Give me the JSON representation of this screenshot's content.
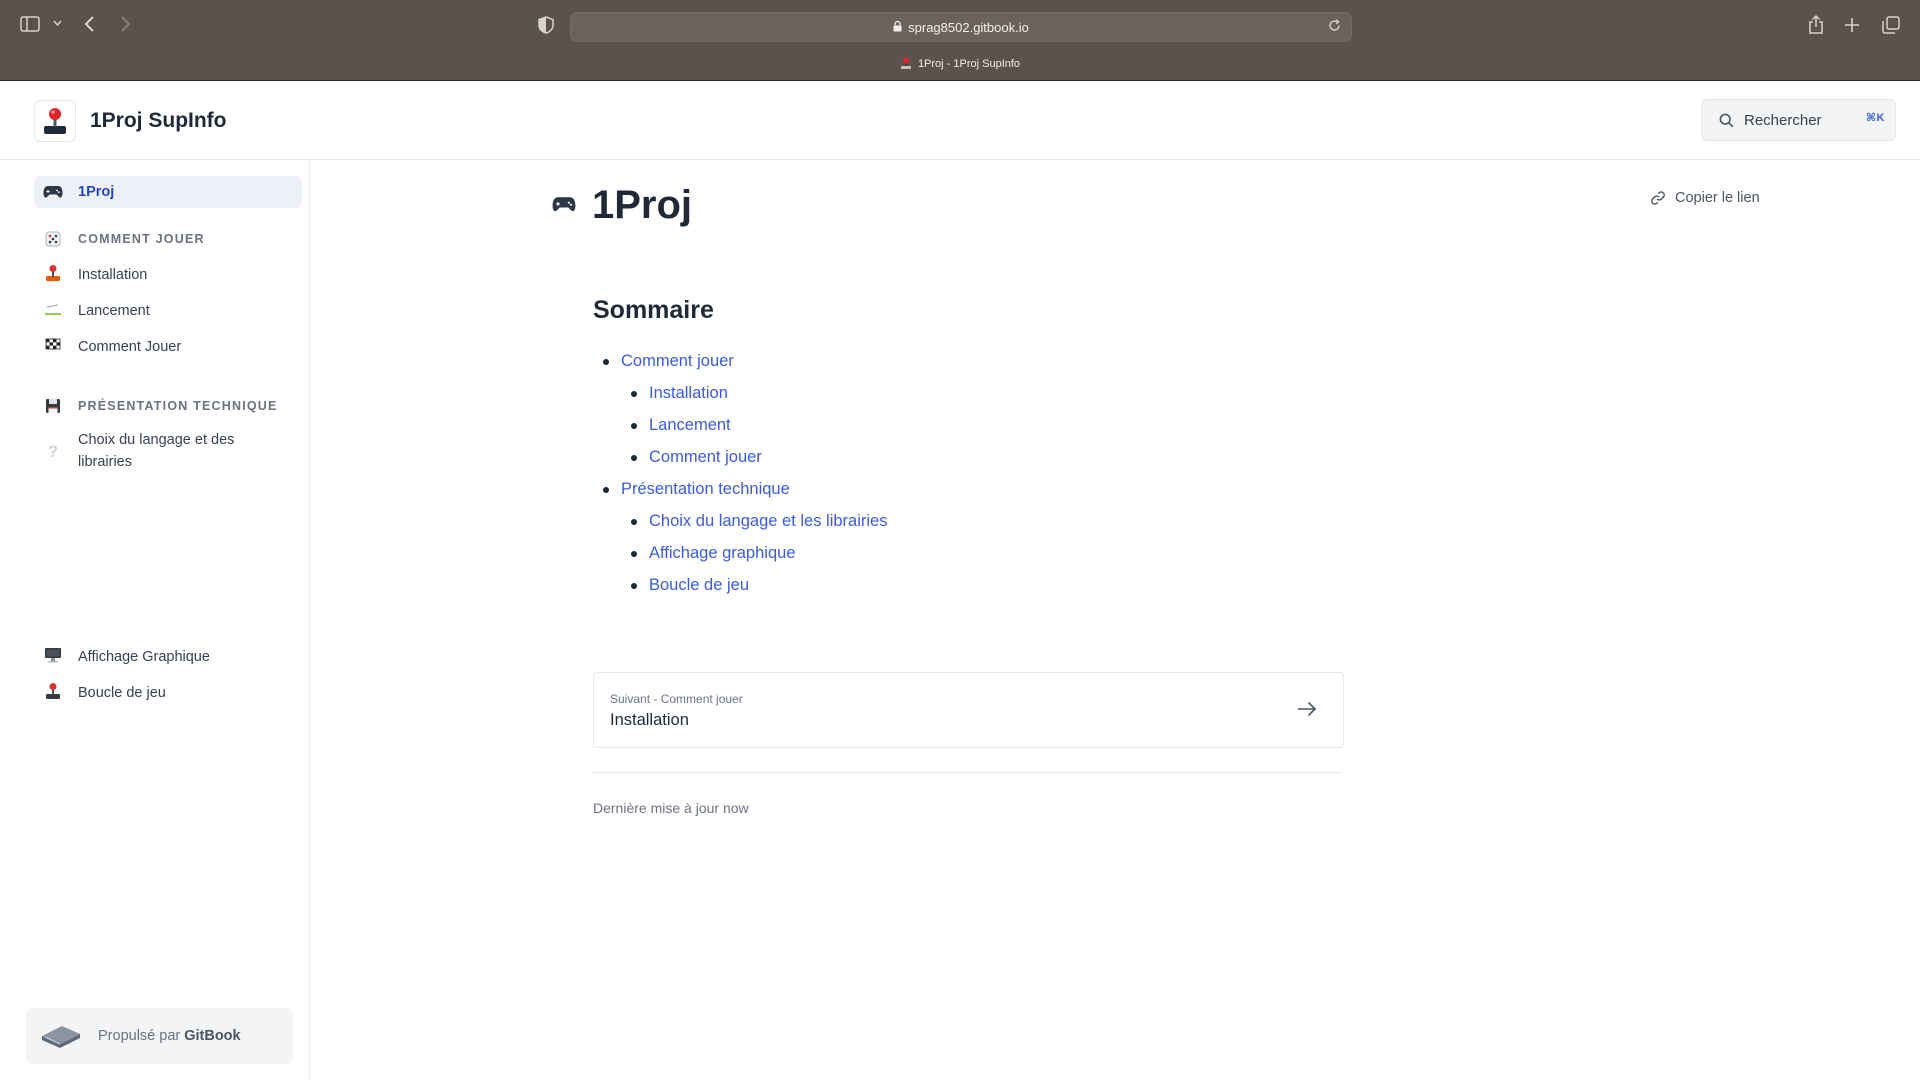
{
  "browser": {
    "url": "sprag8502.gitbook.io",
    "tab_title": "1Proj - 1Proj SupInfo"
  },
  "header": {
    "site_title": "1Proj SupInfo",
    "search_label": "Rechercher",
    "search_shortcut": "⌘K"
  },
  "sidebar": {
    "active_item": "1Proj",
    "section1": "COMMENT JOUER",
    "section1_items": [
      "Installation",
      "Lancement",
      "Comment Jouer"
    ],
    "section2": "PRÉSENTATION TECHNIQUE",
    "section2_items": [
      "Choix du langage et des librairies",
      "Affichage Graphique",
      "Boucle de jeu"
    ],
    "powered_prefix": "Propulsé par",
    "powered_brand": "GitBook"
  },
  "main": {
    "title": "1Proj",
    "copy_link": "Copier le lien",
    "summary_heading": "Sommaire",
    "toc": [
      {
        "label": "Comment jouer",
        "level": 1
      },
      {
        "label": "Installation",
        "level": 2
      },
      {
        "label": "Lancement",
        "level": 2
      },
      {
        "label": "Comment jouer",
        "level": 2
      },
      {
        "label": "Présentation technique",
        "level": 1
      },
      {
        "label": "Choix du langage et les librairies",
        "level": 2
      },
      {
        "label": "Affichage graphique",
        "level": 2
      },
      {
        "label": "Boucle de jeu",
        "level": 2
      }
    ],
    "next_small": "Suivant - Comment jouer",
    "next_title": "Installation",
    "last_update": "Dernière mise à jour now"
  },
  "colors": {
    "chrome": "#5b524c",
    "link": "#3b5bdb",
    "active_nav": "#2447c6"
  }
}
